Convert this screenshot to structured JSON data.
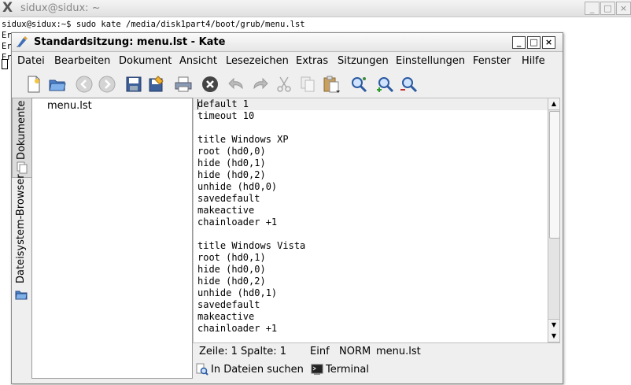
{
  "terminal": {
    "title": "sidux@sidux: ~",
    "command_line": "sidux@sidux:~$ sudo kate /media/disk1part4/boot/grub/menu.lst",
    "partial_lines": [
      "Er",
      "Er",
      "Er"
    ]
  },
  "kate": {
    "title": "Standardsitzung: menu.lst - Kate",
    "window_buttons": [
      "_",
      "□",
      "×"
    ],
    "menu": [
      "Datei",
      "Bearbeiten",
      "Dokument",
      "Ansicht",
      "Lesezeichen",
      "Extras",
      "Sitzungen",
      "Einstellungen",
      "Fenster",
      "Hilfe"
    ],
    "toolbar_icons": [
      "new-document-icon",
      "open-folder-icon",
      "back-icon",
      "forward-icon",
      "save-icon",
      "save-as-icon",
      "print-icon",
      "close-document-icon",
      "undo-icon",
      "redo-icon",
      "cut-icon",
      "copy-icon",
      "paste-icon",
      "find-icon",
      "zoom-in-icon",
      "zoom-out-icon"
    ],
    "side_tabs": [
      "Dokumente",
      "Dateisystem-Browser"
    ],
    "document_list": [
      "menu.lst"
    ],
    "editor_lines": [
      "default 1",
      "timeout 10",
      "",
      "title Windows XP",
      "root (hd0,0)",
      "hide (hd0,1)",
      "hide (hd0,2)",
      "unhide (hd0,0)",
      "savedefault",
      "makeactive",
      "chainloader +1",
      "",
      "title Windows Vista",
      "root (hd0,1)",
      "hide (hd0,0)",
      "hide (hd0,2)",
      "unhide (hd0,1)",
      "savedefault",
      "makeactive",
      "chainloader +1"
    ],
    "status": {
      "position": "Zeile: 1 Spalte: 1",
      "insert_mode": "Einf",
      "edit_mode": "NORM",
      "filename": "menu.lst"
    },
    "bottom_tools": [
      "In Dateien suchen",
      "Terminal"
    ]
  }
}
